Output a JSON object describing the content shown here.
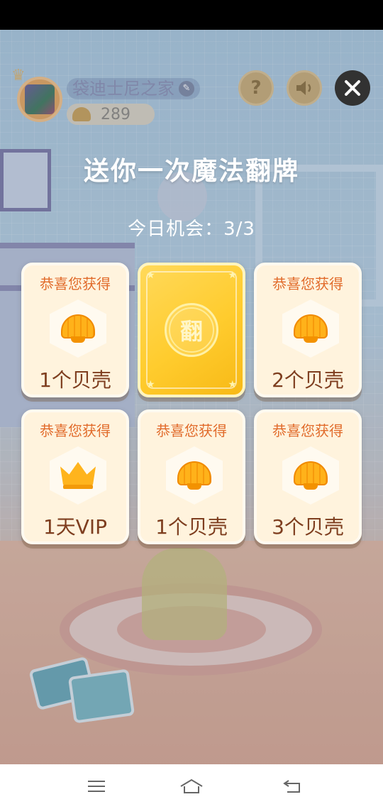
{
  "header": {
    "username": "袋迪士尼之家",
    "shell_count": "289"
  },
  "popup": {
    "title": "送你一次魔法翻牌",
    "chances": "今日机会：3/3",
    "cards": [
      {
        "header": "恭喜您获得",
        "icon": "shell-icon",
        "label": "1个贝壳"
      },
      {
        "face_down": true,
        "text": "翻"
      },
      {
        "header": "恭喜您获得",
        "icon": "shell-icon",
        "label": "2个贝壳"
      },
      {
        "header": "恭喜您获得",
        "icon": "crown-icon",
        "label": "1天VIP"
      },
      {
        "header": "恭喜您获得",
        "icon": "shell-icon",
        "label": "1个贝壳"
      },
      {
        "header": "恭喜您获得",
        "icon": "shell-icon",
        "label": "3个贝壳"
      }
    ]
  },
  "colors": {
    "card_header": "#e16b2b",
    "card_label": "#7e3e1f",
    "card_face_down": "#ffcc2e",
    "shell_gold": "#ffb21a"
  }
}
